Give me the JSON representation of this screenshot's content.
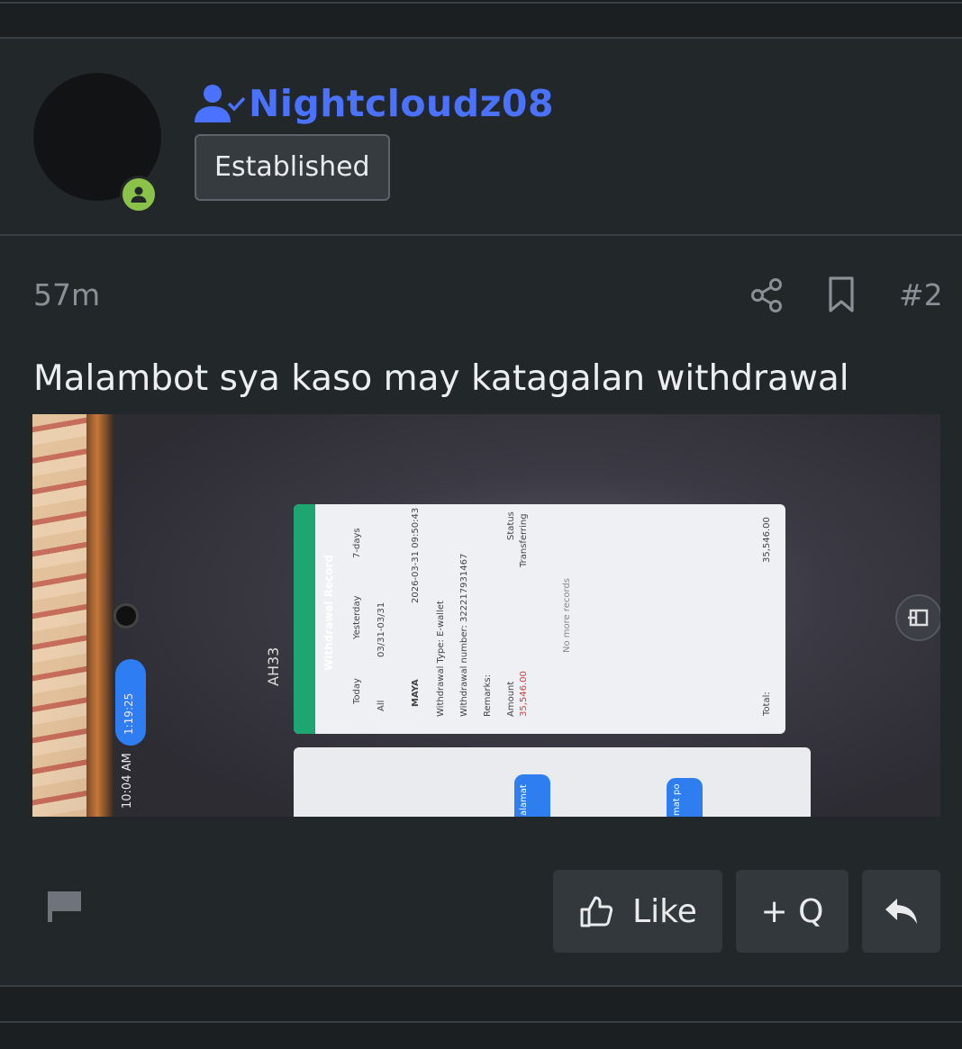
{
  "user": {
    "name": "Nightcloudz08",
    "rank": "Established",
    "status": "online"
  },
  "post": {
    "time": "57m",
    "number": "#2",
    "text": "Malambot sya kaso may katagalan withdrawal"
  },
  "attachment": {
    "clock": "10:04 AM",
    "call_timer": "1:19:25",
    "app_name": "AH33",
    "record_title": "Withdrawal Record",
    "tabs": [
      "Today",
      "Yesterday",
      "7-days"
    ],
    "filter_all": "All",
    "date_range": "03/31-03/31",
    "datetime": "2026-03-31 09:50:43",
    "method": "MAYA",
    "withdrawal_type": "Withdrawal Type:  E-wallet",
    "withdrawal_number": "Withdrawal number:  322217931467",
    "remarks": "Remarks:",
    "amount_label": "Amount",
    "amount_value": "35,546.00",
    "status_label": "Status",
    "status_value": "Transferring",
    "no_more": "No more records",
    "total_label": "Total:",
    "total_value": "35,546.00",
    "chat_snippet_1": "alamat",
    "chat_snippet_2": "mat po"
  },
  "actions": {
    "like": "Like",
    "quote": "+ Q"
  },
  "colors": {
    "username": "#4a72ff",
    "online": "#8bc34a",
    "background": "#22272a"
  },
  "icons": [
    "user-check-icon",
    "online-status-icon",
    "share-icon",
    "bookmark-icon",
    "flag-icon",
    "thumbs-up-icon",
    "reply-icon"
  ]
}
